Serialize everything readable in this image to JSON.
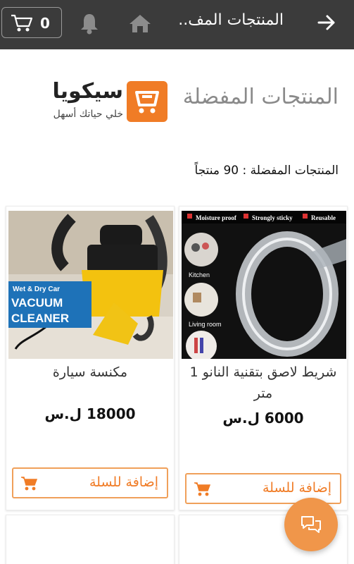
{
  "topbar": {
    "title": "المنتجات المف..",
    "cart_count": "0",
    "icons": [
      "back-arrow-icon",
      "home-icon",
      "bell-icon",
      "cart-icon"
    ]
  },
  "logo": {
    "name": "سيكويا",
    "tagline": "خلي حياتك أسهل"
  },
  "page": {
    "heading": "المنتجات المفضلة",
    "count_label": "المنتجات المفضلة :",
    "count_value": "90 منتجاً"
  },
  "products": [
    {
      "name": "شريط لاصق بتقنية النانو 1 متر",
      "price": "6000 ل.س",
      "button": "إضافة للسلة",
      "image_labels": [
        "Moisture proof",
        "Strongly sticky",
        "Reusable",
        "Kitchen",
        "Living room"
      ]
    },
    {
      "name": "مكنسة سيارة",
      "price": "18000 ل.س",
      "button": "إضافة للسلة",
      "image_labels": [
        "Wet & Dry Car",
        "VACUUM",
        "CLEANER"
      ]
    }
  ],
  "colors": {
    "topbar": "#3b3b3b",
    "accent": "#f07c26",
    "fab": "#f0964a"
  }
}
